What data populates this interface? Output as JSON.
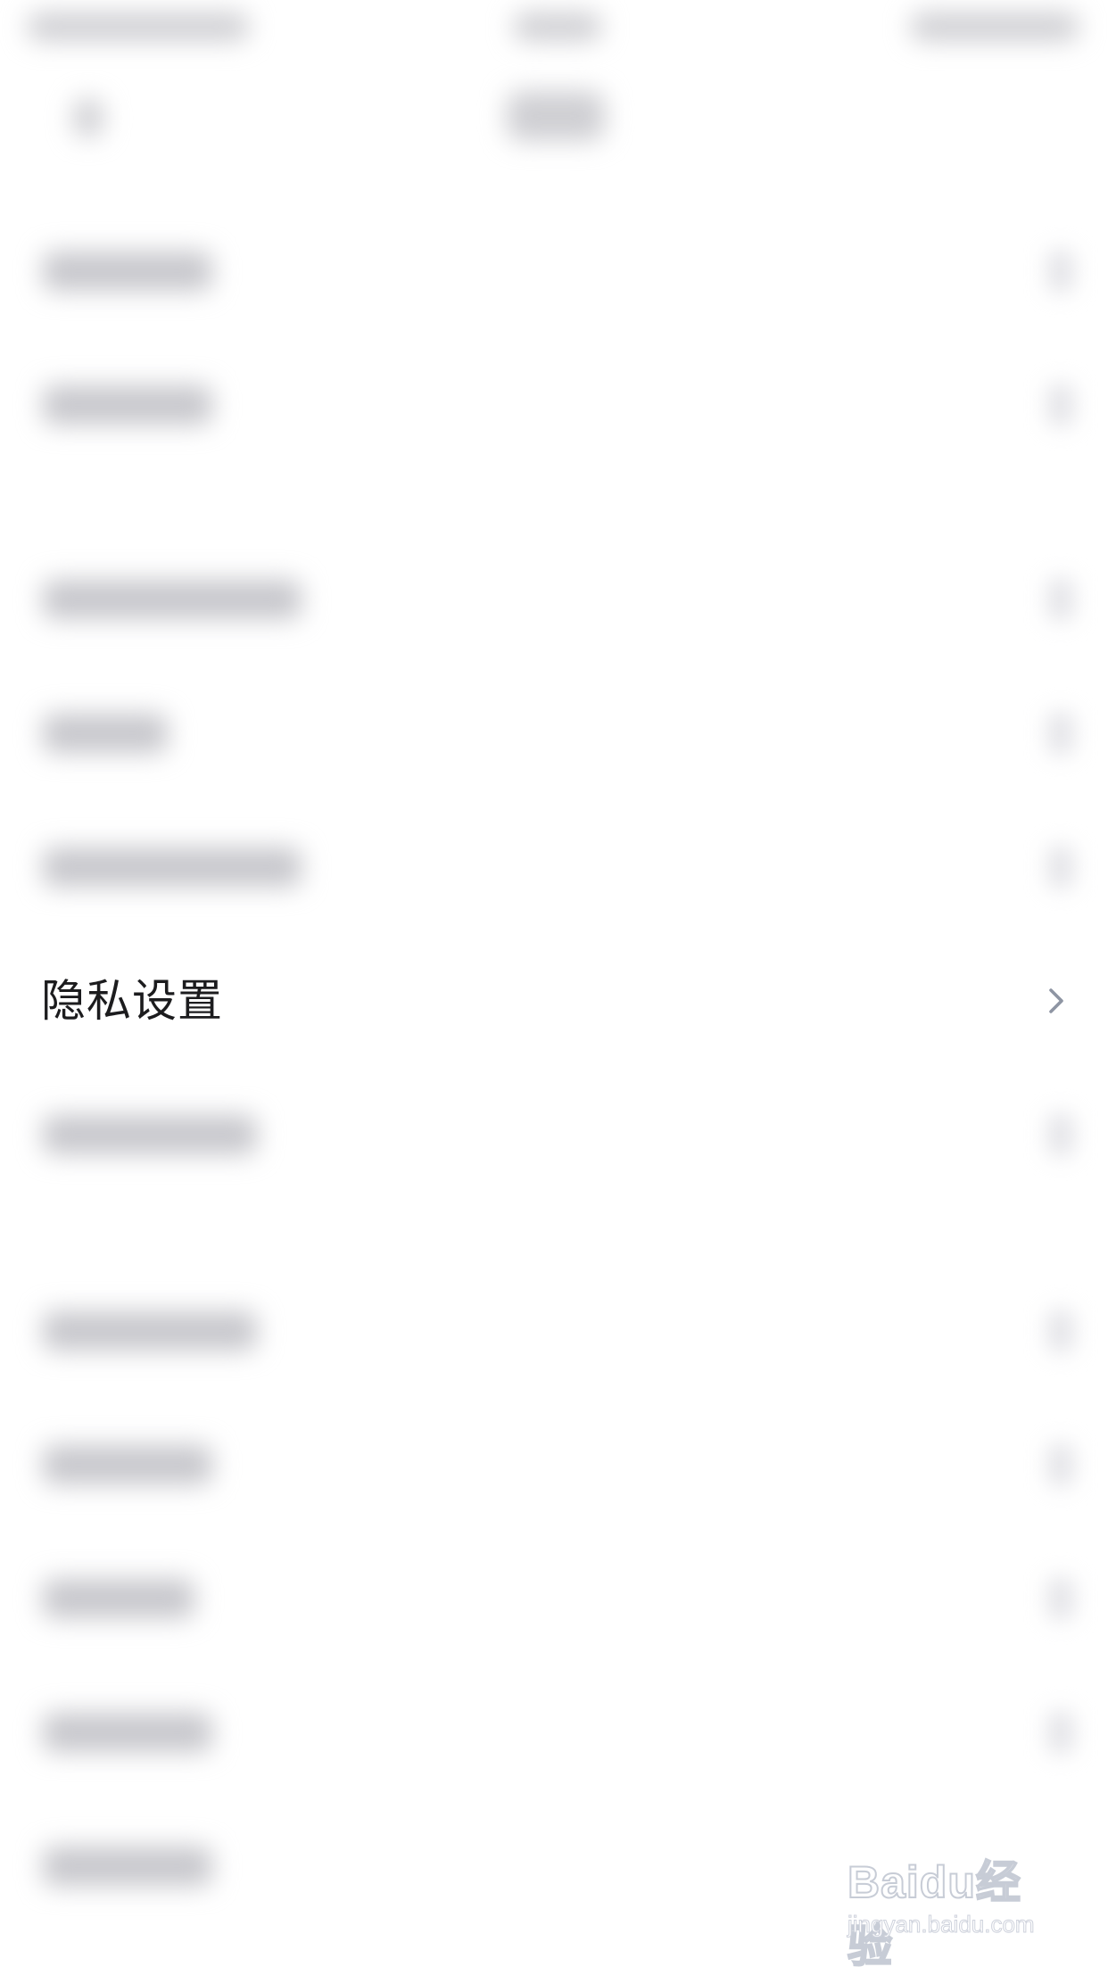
{
  "settings_list": {
    "focused_item": {
      "label": "隐私设置",
      "icon": "chevron-right-icon"
    }
  },
  "watermark": {
    "brand": "Baidu经验",
    "url": "jingyan.baidu.com"
  },
  "colors": {
    "label": "#1c1c1e",
    "chevron": "#8e95a3",
    "background": "#ffffff"
  }
}
